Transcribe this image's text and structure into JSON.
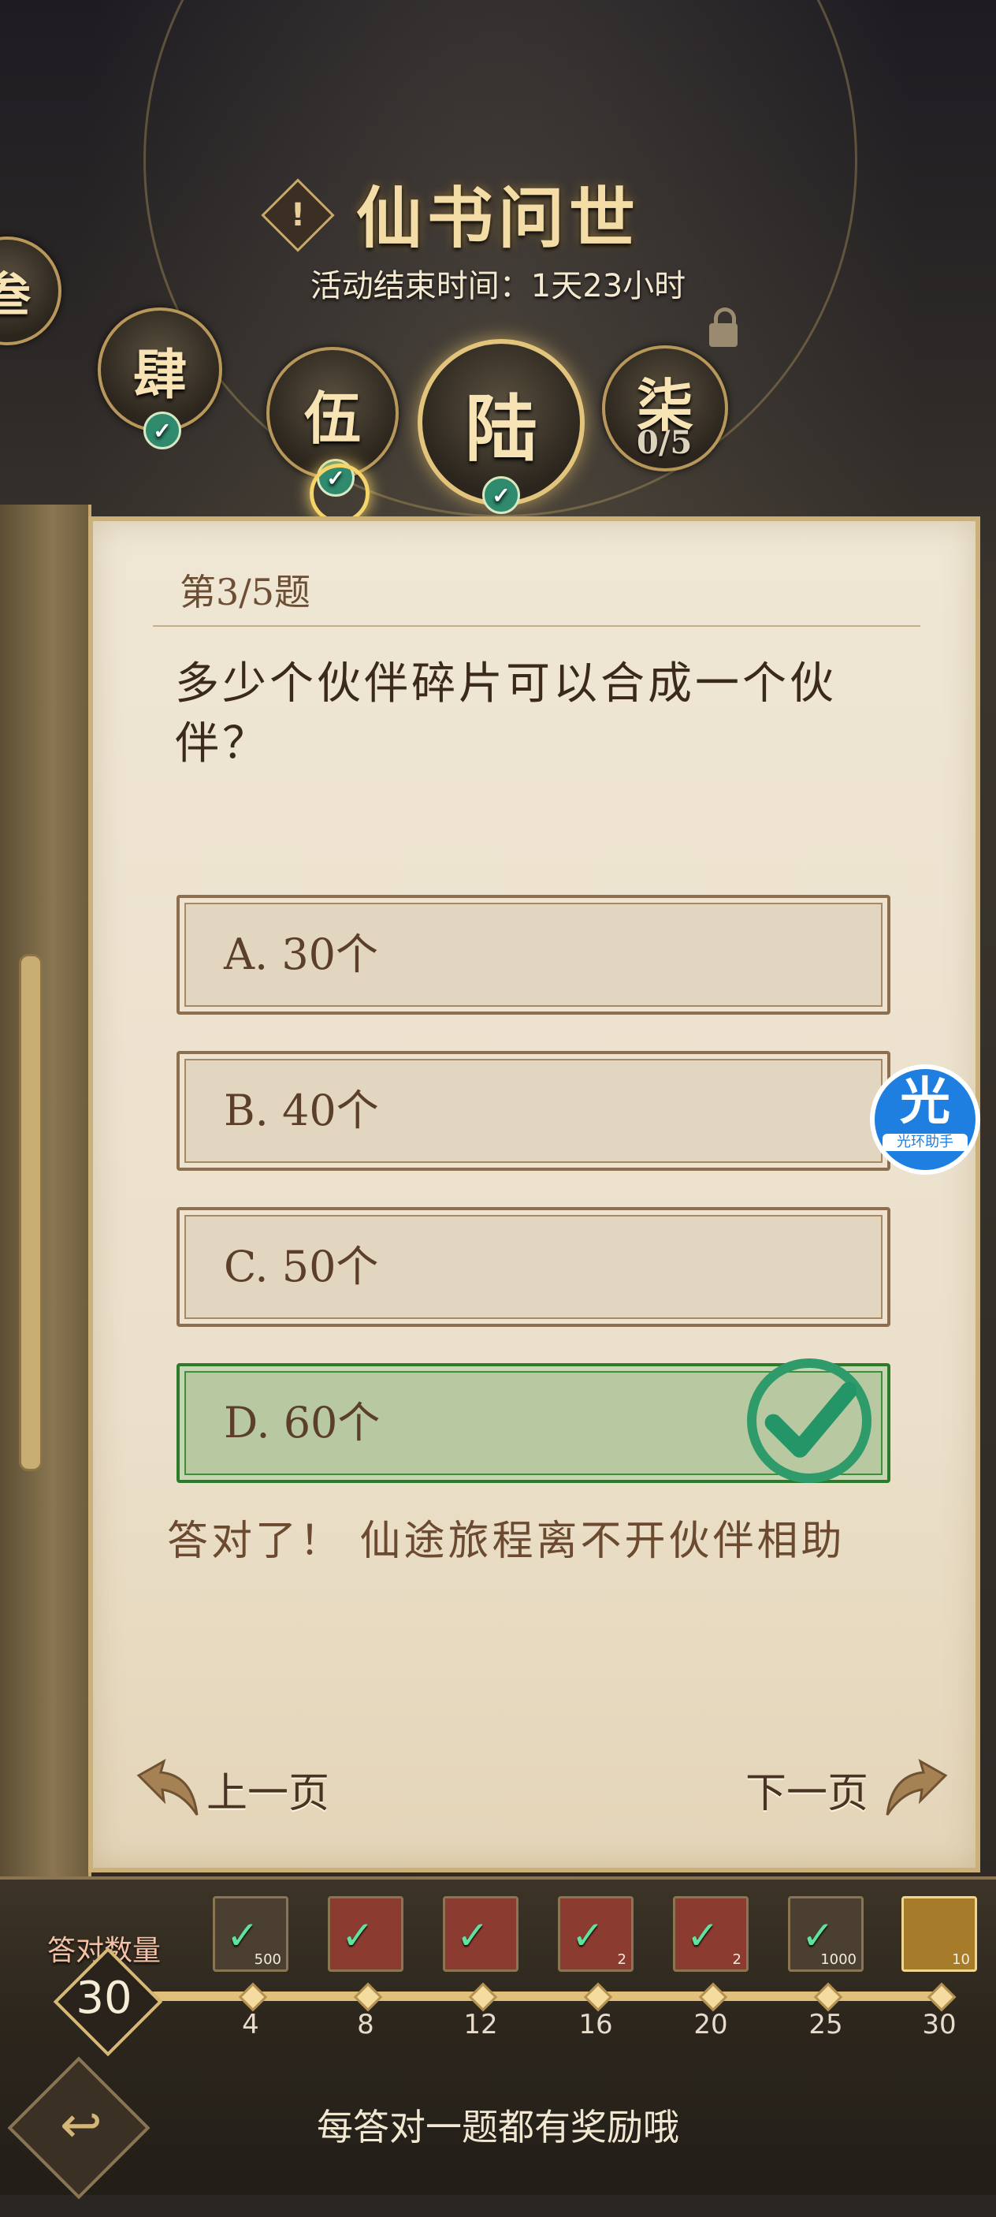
{
  "header": {
    "title": "仙书问世",
    "end_time": "活动结束时间：1天23小时",
    "notice_symbol": "!"
  },
  "chapters": [
    {
      "label": "叁",
      "done": true
    },
    {
      "label": "肆",
      "done": true
    },
    {
      "label": "伍",
      "done": true
    },
    {
      "label": "陆",
      "done": true,
      "active": true
    },
    {
      "label": "柒",
      "done": false,
      "locked": true,
      "progress": "0/5"
    }
  ],
  "quiz": {
    "number": "第3/5题",
    "question": "多少个伙伴碎片可以合成一个伙伴？",
    "options": [
      {
        "label": "A. 30个"
      },
      {
        "label": "B. 40个"
      },
      {
        "label": "C. 50个"
      },
      {
        "label": "D. 60个",
        "correct": true
      }
    ],
    "feedback": "答对了！ 仙途旅程离不开伙伴相助",
    "prev": "上一页",
    "next": "下一页"
  },
  "widget": {
    "main": "光",
    "sub": "光环助手"
  },
  "rewards": {
    "label": "答对数量",
    "count": "30",
    "milestones": [
      "4",
      "8",
      "12",
      "16",
      "20",
      "25",
      "30"
    ],
    "chests": [
      {
        "qty": "500",
        "claimed": true
      },
      {
        "qty": "",
        "claimed": true
      },
      {
        "qty": "",
        "claimed": true
      },
      {
        "qty": "2",
        "claimed": true
      },
      {
        "qty": "2",
        "claimed": true
      },
      {
        "qty": "1000",
        "claimed": true
      },
      {
        "qty": "10",
        "claimed": false
      }
    ]
  },
  "footer": {
    "hint": "每答对一题都有奖励哦",
    "back_icon": "↩"
  }
}
